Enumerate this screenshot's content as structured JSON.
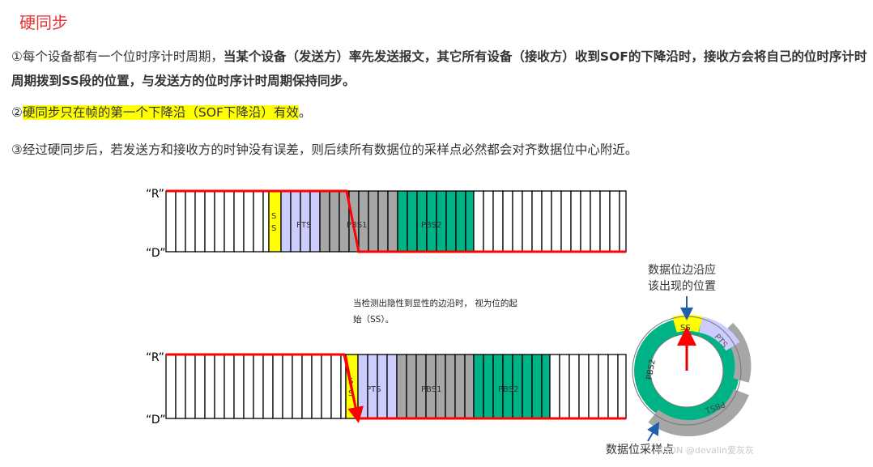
{
  "title": "硬同步",
  "paragraphs": {
    "p1_prefix": "①每个设备都有一个位时序计时周期，",
    "p1_bold": "当某个设备（发送方）率先发送报文，其它所有设备（接收方）收到SOF的下降沿时，接收方会将自己的位时序计时周期拨到SS段的位置，与发送方的位时序计时周期保持同步。",
    "p2_prefix": "②",
    "p2_highlight": "硬同步只在帧的第一个下降沿（SOF下降沿）有效",
    "p2_suffix": "。",
    "p3": "③经过硬同步后，若发送方和接收方的时钟没有误差，则后续所有数据位的采样点必然都会对齐数据位中心附近。"
  },
  "diagram": {
    "level_recessive": "“R”",
    "level_dominant": "“D”",
    "segments": {
      "ss": "S S",
      "pts": "PTS",
      "pbs1": "PBS1",
      "pbs2": "PBS2"
    },
    "caption_line1": "当检测出隐性到显性的边沿时， 视为位的起",
    "caption_line2": "始（SS）。",
    "edge_label_line1": "数据位边沿应",
    "edge_label_line2": "该出现的位置",
    "ring_labels": {
      "ss": "SS",
      "pts": "PTS",
      "pbs1": "PBS1",
      "pbs2": "PBS2"
    },
    "sample_label": "数据位采样点",
    "watermark": "CSDN @devalin爱灰灰"
  },
  "colors": {
    "title": "#e53333",
    "signal": "#ff0000",
    "ss": "#ffff00",
    "pts": "#ccccff",
    "pbs1": "#a6a6a6",
    "pbs2": "#00b386",
    "arrow": "#1f5fae"
  }
}
